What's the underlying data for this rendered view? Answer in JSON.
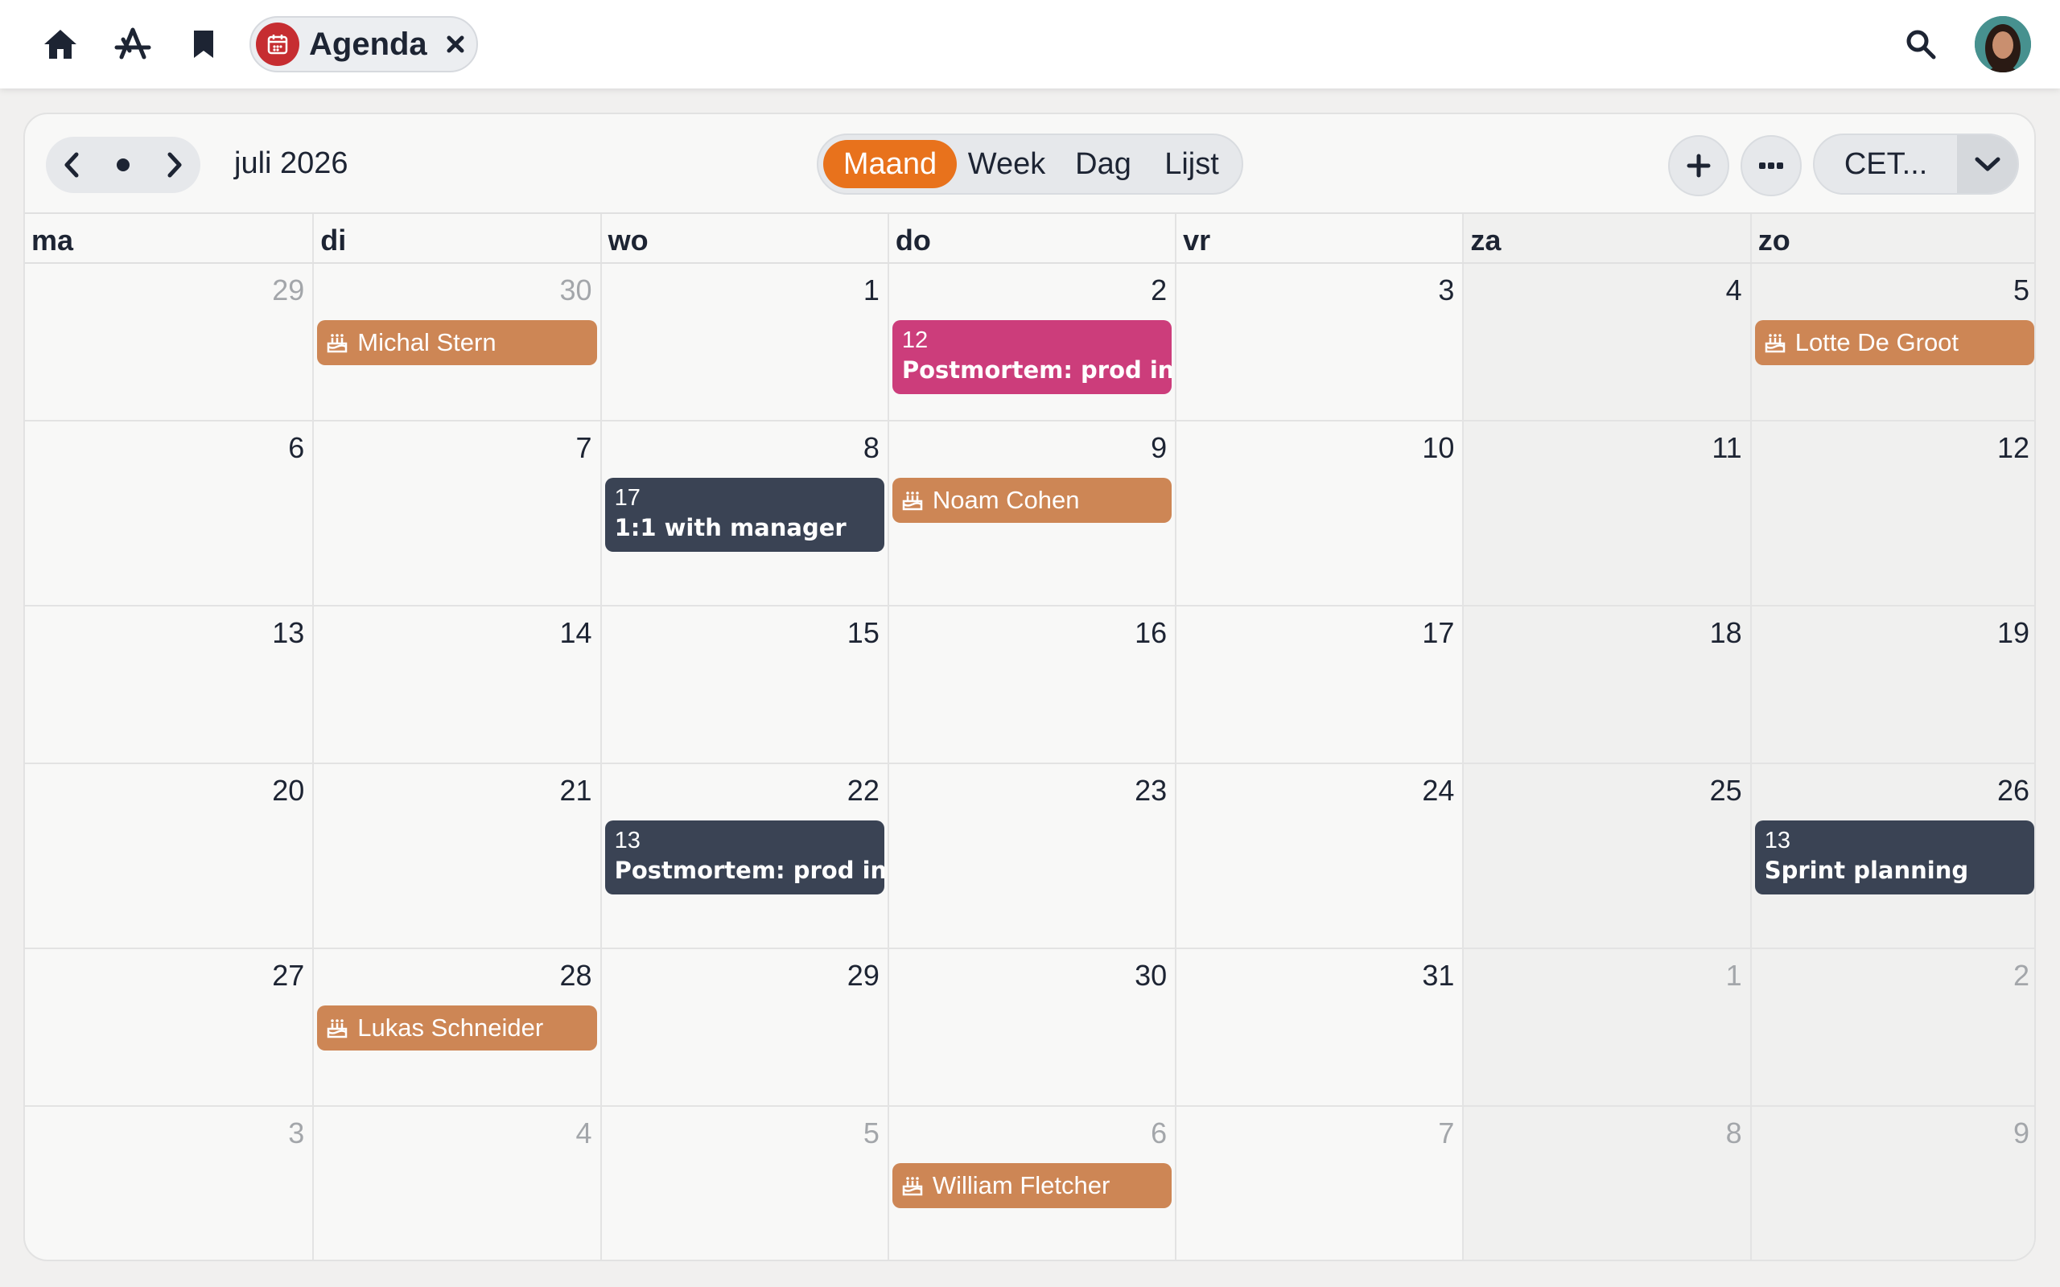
{
  "topbar": {
    "icons": [
      "home-icon",
      "app-store-icon",
      "bookmark-icon",
      "search-icon"
    ],
    "tab": {
      "label": "Agenda",
      "icon": "calendar-icon"
    }
  },
  "calendar": {
    "month_title": "juli 2026",
    "views": [
      "Maand",
      "Week",
      "Dag",
      "Lijst"
    ],
    "active_view": "Maand",
    "timezone": "CET...",
    "accent_color": "#e8721c",
    "weekdays": [
      "ma",
      "di",
      "wo",
      "do",
      "vr",
      "za",
      "zo"
    ],
    "weeks": [
      [
        {
          "day": "29",
          "other": true,
          "events": []
        },
        {
          "day": "30",
          "other": true,
          "events": [
            {
              "type": "birthday",
              "title": "Michal Stern"
            }
          ]
        },
        {
          "day": "1",
          "events": []
        },
        {
          "day": "2",
          "events": [
            {
              "type": "timed",
              "color": "pink",
              "time": "12",
              "title": "Postmortem: prod in"
            }
          ]
        },
        {
          "day": "3",
          "events": []
        },
        {
          "day": "4",
          "events": []
        },
        {
          "day": "5",
          "events": [
            {
              "type": "birthday",
              "title": "Lotte De Groot"
            }
          ]
        }
      ],
      [
        {
          "day": "6",
          "events": []
        },
        {
          "day": "7",
          "events": []
        },
        {
          "day": "8",
          "events": [
            {
              "type": "timed",
              "color": "dark",
              "time": "17",
              "title": "1:1 with manager"
            }
          ]
        },
        {
          "day": "9",
          "events": [
            {
              "type": "birthday",
              "title": "Noam Cohen"
            }
          ]
        },
        {
          "day": "10",
          "events": []
        },
        {
          "day": "11",
          "events": []
        },
        {
          "day": "12",
          "events": []
        }
      ],
      [
        {
          "day": "13",
          "events": []
        },
        {
          "day": "14",
          "events": []
        },
        {
          "day": "15",
          "events": []
        },
        {
          "day": "16",
          "events": []
        },
        {
          "day": "17",
          "events": []
        },
        {
          "day": "18",
          "events": []
        },
        {
          "day": "19",
          "events": []
        }
      ],
      [
        {
          "day": "20",
          "events": []
        },
        {
          "day": "21",
          "events": []
        },
        {
          "day": "22",
          "events": [
            {
              "type": "timed",
              "color": "dark",
              "time": "13",
              "title": "Postmortem: prod in"
            }
          ]
        },
        {
          "day": "23",
          "events": []
        },
        {
          "day": "24",
          "events": []
        },
        {
          "day": "25",
          "events": []
        },
        {
          "day": "26",
          "events": [
            {
              "type": "timed",
              "color": "dark",
              "time": "13",
              "title": "Sprint planning"
            }
          ]
        }
      ],
      [
        {
          "day": "27",
          "events": []
        },
        {
          "day": "28",
          "events": [
            {
              "type": "birthday",
              "title": "Lukas Schneider"
            }
          ]
        },
        {
          "day": "29",
          "events": []
        },
        {
          "day": "30",
          "events": []
        },
        {
          "day": "31",
          "events": []
        },
        {
          "day": "1",
          "other": true,
          "events": []
        },
        {
          "day": "2",
          "other": true,
          "events": []
        }
      ],
      [
        {
          "day": "3",
          "other": true,
          "events": []
        },
        {
          "day": "4",
          "other": true,
          "events": []
        },
        {
          "day": "5",
          "other": true,
          "events": []
        },
        {
          "day": "6",
          "other": true,
          "events": [
            {
              "type": "birthday",
              "title": "William Fletcher"
            }
          ]
        },
        {
          "day": "7",
          "other": true,
          "events": []
        },
        {
          "day": "8",
          "other": true,
          "events": []
        },
        {
          "day": "9",
          "other": true,
          "events": []
        }
      ]
    ]
  }
}
